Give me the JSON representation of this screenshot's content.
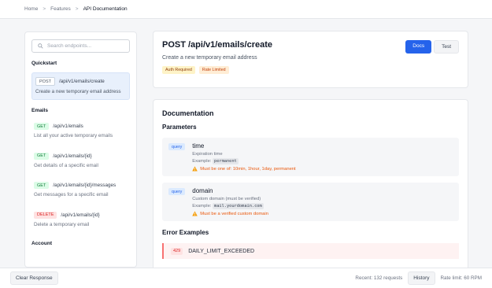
{
  "breadcrumb": {
    "items": [
      "Home",
      "Features",
      "API Documentation"
    ],
    "separator": ">"
  },
  "sidebar": {
    "search_placeholder": "Search endpoints...",
    "sections": [
      {
        "title": "Quickstart",
        "endpoints": [
          {
            "method": "POST",
            "path": "/api/v1/emails/create",
            "desc": "Create a new temporary email address",
            "active": true
          }
        ]
      },
      {
        "title": "Emails",
        "endpoints": [
          {
            "method": "GET",
            "path": "/api/v1/emails",
            "desc": "List all your active temporary emails"
          },
          {
            "method": "GET",
            "path": "/api/v1/emails/{id}",
            "desc": "Get details of a specific email"
          },
          {
            "method": "GET",
            "path": "/api/v1/emails/{id}/messages",
            "desc": "Get messages for a specific email"
          },
          {
            "method": "DELETE",
            "path": "/api/v1/emails/{id}",
            "desc": "Delete a temporary email"
          }
        ]
      },
      {
        "title": "Account",
        "endpoints": []
      }
    ]
  },
  "endpoint": {
    "title": "POST /api/v1/emails/create",
    "subtitle": "Create a new temporary email address",
    "tags": [
      "Auth Required",
      "Rate Limited"
    ],
    "tabs": {
      "docs": "Docs",
      "test": "Test",
      "active": "Docs"
    }
  },
  "documentation": {
    "heading": "Documentation",
    "params_heading": "Parameters",
    "params": [
      {
        "location": "query",
        "name": "time",
        "desc": "Expiration time",
        "example_label": "Example:",
        "example": "permanent",
        "warning": "Must be one of: 10min, 1hour, 1day, permanent"
      },
      {
        "location": "query",
        "name": "domain",
        "desc": "Custom domain (must be verified)",
        "example_label": "Example:",
        "example": "mail.yourdomain.com",
        "warning": "Must be a verified custom domain"
      }
    ],
    "errors_heading": "Error Examples",
    "errors": [
      {
        "code": "429",
        "message": "DAILY_LIMIT_EXCEEDED"
      }
    ]
  },
  "footer": {
    "clear_label": "Clear Response",
    "recent_label": "Recent: 132 requests",
    "history_label": "History",
    "rate_limit_label": "Rate limit: 60 RPM"
  },
  "colors": {
    "accent": "#2563eb",
    "get": "#15803d",
    "delete": "#dc2626",
    "warning": "#ea580c"
  },
  "icons": {
    "search": "search-icon",
    "warning": "warning-icon"
  }
}
